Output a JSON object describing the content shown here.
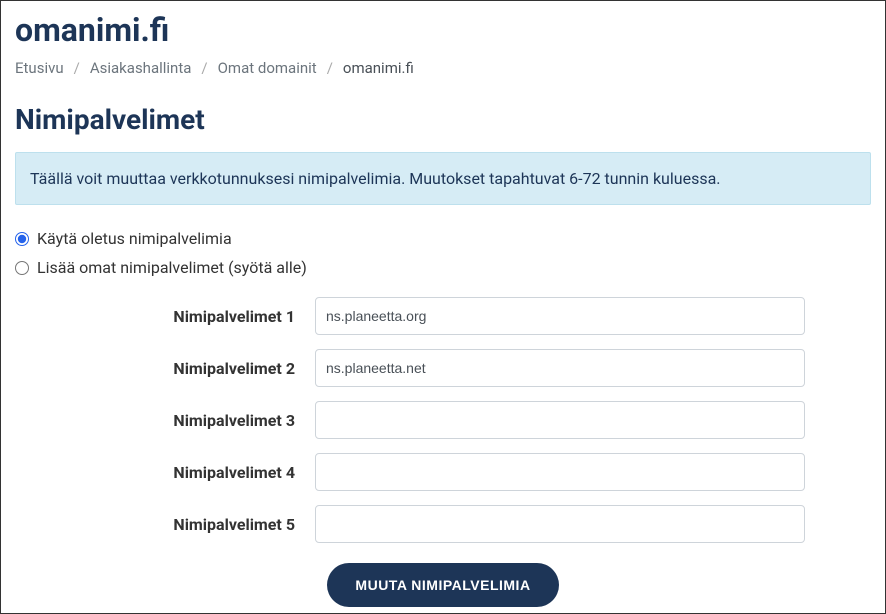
{
  "page": {
    "title": "omanimi.fi"
  },
  "breadcrumb": {
    "items": [
      {
        "label": "Etusivu"
      },
      {
        "label": "Asiakashallinta"
      },
      {
        "label": "Omat domainit"
      }
    ],
    "current": "omanimi.fi"
  },
  "section": {
    "title": "Nimipalvelimet",
    "info": "Täällä voit muuttaa verkkotunnuksesi nimipalvelimia. Muutokset tapahtuvat 6-72 tunnin kuluessa."
  },
  "radios": {
    "default_label": "Käytä oletus nimipalvelimia",
    "custom_label": "Lisää omat nimipalvelimet (syötä alle)"
  },
  "nameservers": [
    {
      "label": "Nimipalvelimet 1",
      "value": "ns.planeetta.org"
    },
    {
      "label": "Nimipalvelimet 2",
      "value": "ns.planeetta.net"
    },
    {
      "label": "Nimipalvelimet 3",
      "value": ""
    },
    {
      "label": "Nimipalvelimet 4",
      "value": ""
    },
    {
      "label": "Nimipalvelimet 5",
      "value": ""
    }
  ],
  "submit": {
    "label": "MUUTA NIMIPALVELIMIA"
  }
}
